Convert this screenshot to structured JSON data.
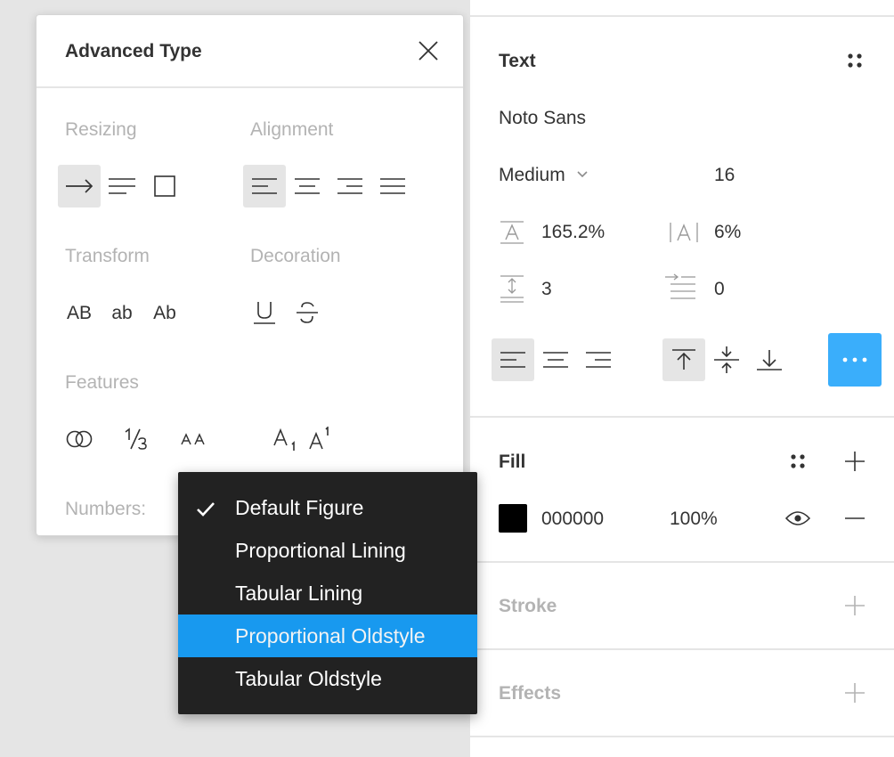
{
  "advanced_type": {
    "title": "Advanced Type",
    "close_icon": "close-icon",
    "resizing_label": "Resizing",
    "alignment_label": "Alignment",
    "transform_label": "Transform",
    "decoration_label": "Decoration",
    "features_label": "Features",
    "numbers_label": "Numbers:",
    "transform": {
      "upper": "AB",
      "lower": "ab",
      "title": "Ab"
    },
    "resizing_selected": "auto-width",
    "alignment_selected": "left"
  },
  "numbers_dropdown": {
    "items": [
      {
        "label": "Default Figure",
        "checked": true,
        "highlighted": false
      },
      {
        "label": "Proportional Lining",
        "checked": false,
        "highlighted": false
      },
      {
        "label": "Tabular Lining",
        "checked": false,
        "highlighted": false
      },
      {
        "label": "Proportional Oldstyle",
        "checked": false,
        "highlighted": true
      },
      {
        "label": "Tabular Oldstyle",
        "checked": false,
        "highlighted": false
      }
    ]
  },
  "text_section": {
    "title": "Text",
    "font_family": "Noto Sans",
    "font_weight": "Medium",
    "font_size": "16",
    "line_height": "165.2%",
    "letter_spacing": "6%",
    "paragraph_spacing": "3",
    "paragraph_indent": "0",
    "text_align_selected": "left",
    "vertical_align_selected": "top"
  },
  "fill_section": {
    "title": "Fill",
    "hex": "000000",
    "opacity": "100%",
    "color": "#000000"
  },
  "stroke_section": {
    "title": "Stroke"
  },
  "effects_section": {
    "title": "Effects"
  },
  "colors": {
    "accent": "#18a0fb",
    "panel_bg": "#ffffff",
    "canvas_bg": "#e5e5e5",
    "menu_bg": "#222222"
  }
}
